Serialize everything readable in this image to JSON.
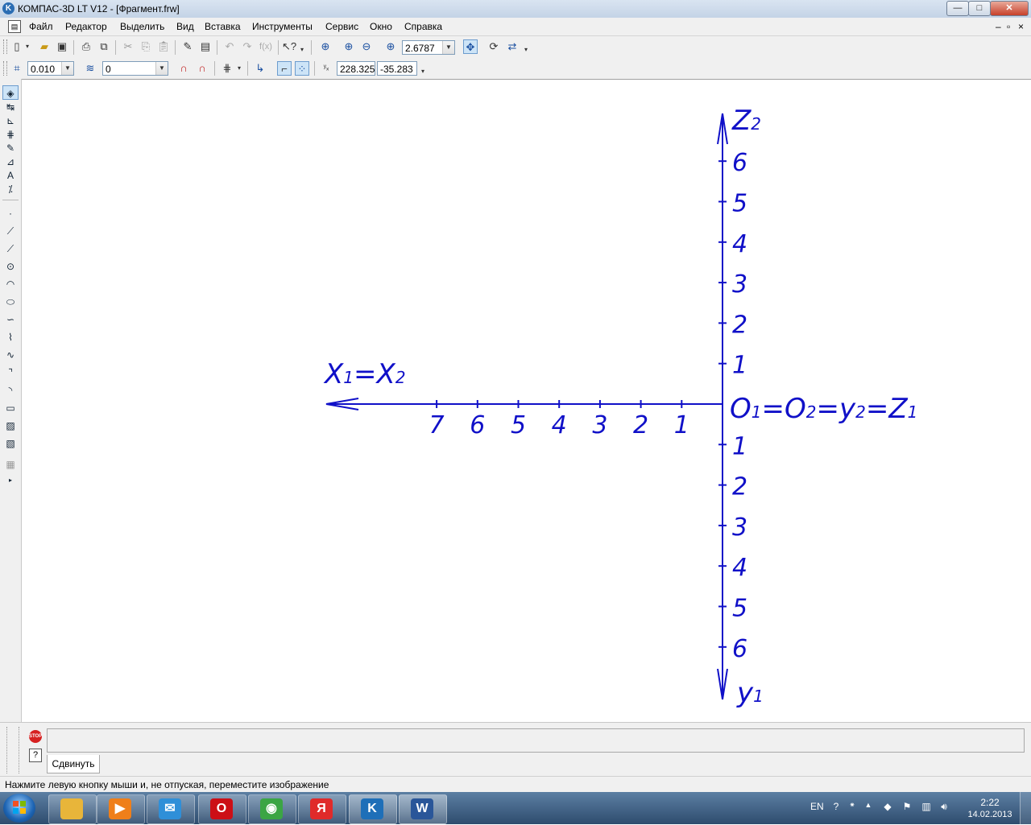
{
  "window": {
    "title": "КОМПАС-3D LT V12 - [Фрагмент.frw]",
    "app_icon_letter": "K",
    "minimize": "—",
    "maximize": "□",
    "close": "✕"
  },
  "menu": {
    "items": [
      "Файл",
      "Редактор",
      "Выделить",
      "Вид",
      "Вставка",
      "Инструменты",
      "Сервис",
      "Окно",
      "Справка"
    ],
    "mdi_controls": [
      "–",
      "▫",
      "×"
    ]
  },
  "standard_toolbar": {
    "zoom_value": "2.6787"
  },
  "current_state_toolbar": {
    "step_value": "0.010",
    "layer_value": "0",
    "coord_x": "228.325",
    "coord_y": "-35.283"
  },
  "drawing": {
    "color": "#1010c8",
    "x_axis_label": "X",
    "x_axis_label_sub": "1",
    "x_axis_label2": "X",
    "x_axis_label2_sub": "2",
    "z_axis_label": "Z",
    "z_axis_label_sub": "2",
    "y_axis_label": "y",
    "y_axis_label_sub": "1",
    "origin_parts": [
      {
        "main": "O",
        "sub": "1"
      },
      {
        "main": "O",
        "sub": "2"
      },
      {
        "main": "y",
        "sub": "2"
      },
      {
        "main": "Z",
        "sub": "1"
      }
    ],
    "x_ticks": [
      "7",
      "6",
      "5",
      "4",
      "3",
      "2",
      "1"
    ],
    "z_ticks_up": [
      "6",
      "5",
      "4",
      "3",
      "2",
      "1"
    ],
    "y_ticks_down": [
      "1",
      "2",
      "3",
      "4",
      "5",
      "6"
    ]
  },
  "bottom_panel": {
    "stop_label": "STOP",
    "help_label": "?",
    "tab_label": "Сдвинуть"
  },
  "status_bar": {
    "message": "Нажмите левую кнопку мыши и, не отпуская, переместите изображение"
  },
  "taskbar": {
    "language": "EN",
    "time": "2:22",
    "date": "14.02.2013",
    "apps": [
      {
        "icon": "explorer-icon",
        "color": "#e8b53a",
        "glyph": ""
      },
      {
        "icon": "media-player-icon",
        "color": "#ef7f1a",
        "glyph": "▶"
      },
      {
        "icon": "mail-icon",
        "color": "#2f8fd8",
        "glyph": "✉"
      },
      {
        "icon": "opera-icon",
        "color": "#cc0f16",
        "glyph": "O"
      },
      {
        "icon": "chrome-icon",
        "color": "#3ba544",
        "glyph": "◉"
      },
      {
        "icon": "yandex-icon",
        "color": "#e02a2a",
        "glyph": "Я"
      },
      {
        "icon": "kompas-icon",
        "color": "#1e6fb8",
        "glyph": "K"
      },
      {
        "icon": "word-icon",
        "color": "#2a5699",
        "glyph": "W"
      }
    ]
  }
}
